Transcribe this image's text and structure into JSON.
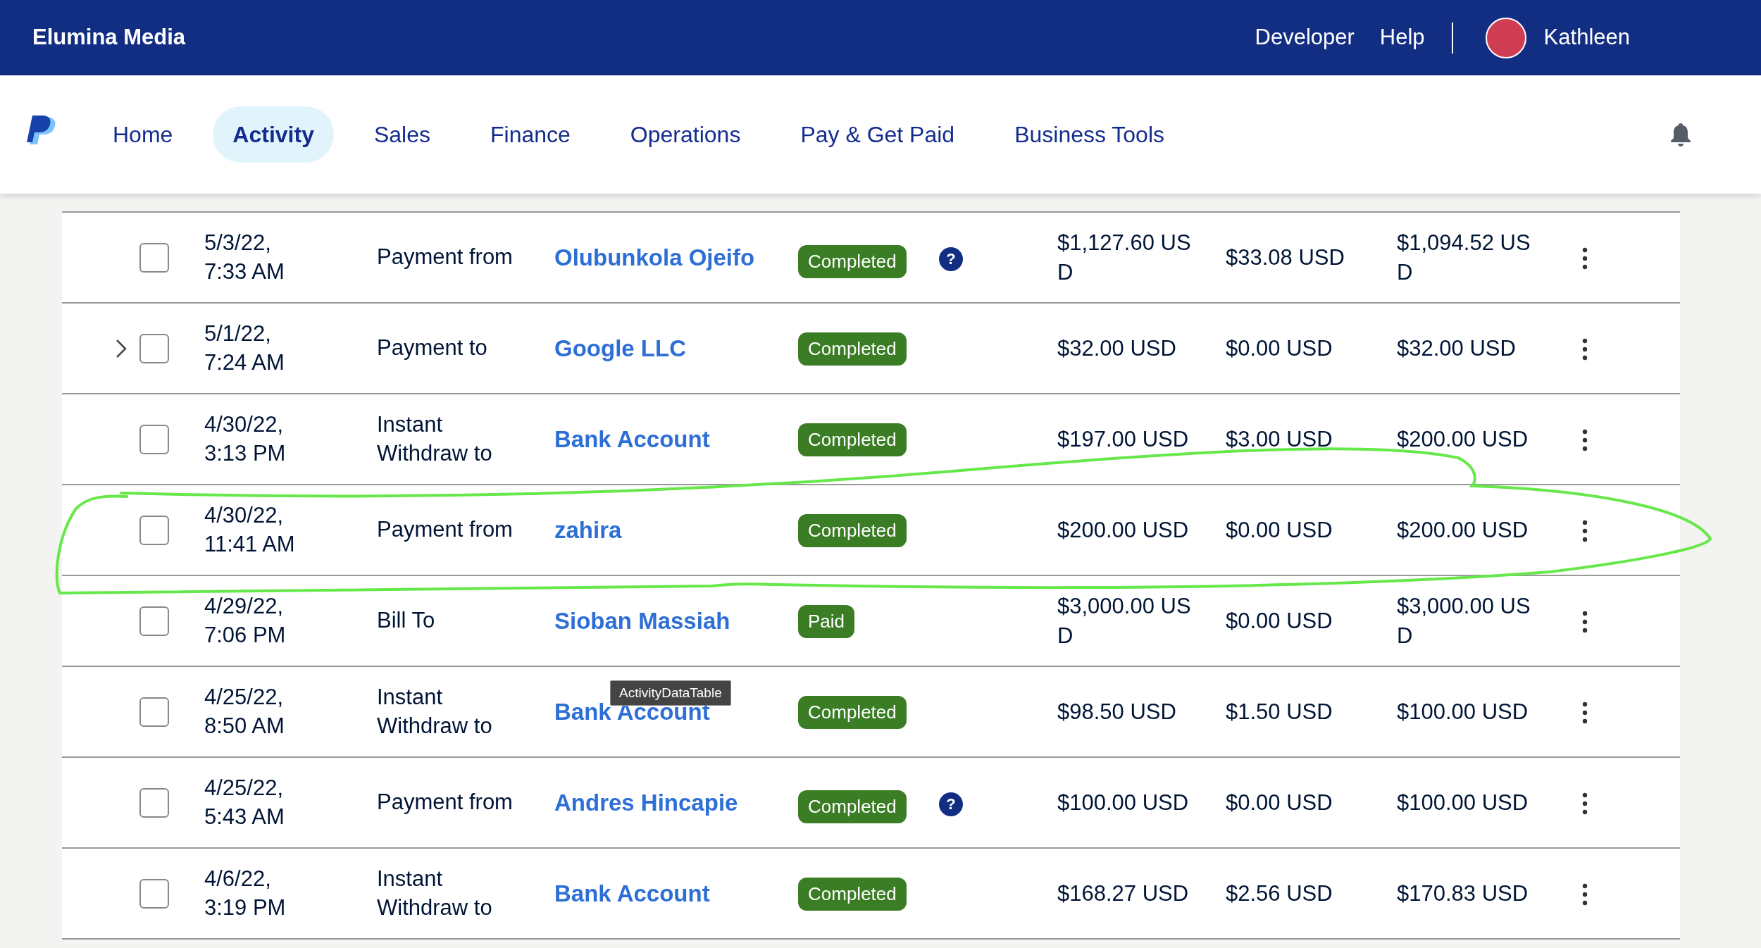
{
  "top_bar": {
    "brand": "Elumina Media",
    "links": [
      "Developer",
      "Help"
    ],
    "user": {
      "name": "Kathleen"
    }
  },
  "nav": {
    "tabs": [
      {
        "label": "Home",
        "selected": false
      },
      {
        "label": "Activity",
        "selected": true
      },
      {
        "label": "Sales",
        "selected": false
      },
      {
        "label": "Finance",
        "selected": false
      },
      {
        "label": "Operations",
        "selected": false
      },
      {
        "label": "Pay & Get Paid",
        "selected": false
      },
      {
        "label": "Business Tools",
        "selected": false
      }
    ]
  },
  "table": {
    "rows": [
      {
        "expandable": false,
        "checked": false,
        "date": "5/3/22,",
        "time": "7:33 AM",
        "type": "Payment from",
        "name": "Olubunkola Ojeifo",
        "status": "Completed",
        "help": "?",
        "gross": "$1,127.60 USD",
        "fee": "$33.08 USD",
        "net": "$1,094.52 USD"
      },
      {
        "expandable": true,
        "checked": false,
        "date": "5/1/22,",
        "time": "7:24 AM",
        "type": "Payment to",
        "name": "Google LLC",
        "status": "Completed",
        "gross": "$32.00 USD",
        "fee": "$0.00 USD",
        "net": "$32.00 USD"
      },
      {
        "expandable": false,
        "checked": false,
        "date": "4/30/22,",
        "time": "3:13 PM",
        "type": "Instant Withdraw to",
        "name": "Bank Account",
        "status": "Completed",
        "gross": "$197.00 USD",
        "fee": "$3.00 USD",
        "net": "$200.00 USD"
      },
      {
        "expandable": false,
        "checked": false,
        "date": "4/30/22,",
        "time": "11:41 AM",
        "type": "Payment from",
        "name": "zahira",
        "status": "Completed",
        "gross": "$200.00 USD",
        "fee": "$0.00 USD",
        "net": "$200.00 USD"
      },
      {
        "expandable": false,
        "checked": false,
        "date": "4/29/22,",
        "time": "7:06 PM",
        "type": "Bill To",
        "name": "Sioban Massiah",
        "status": "Paid",
        "gross": "$3,000.00 USD",
        "fee": "$0.00 USD",
        "net": "$3,000.00 USD"
      },
      {
        "expandable": false,
        "checked": false,
        "date": "4/25/22,",
        "time": "8:50 AM",
        "type": "Instant Withdraw to",
        "name": "Bank Account",
        "status": "Completed",
        "tooltip": "ActivityDataTable",
        "gross": "$98.50 USD",
        "fee": "$1.50 USD",
        "net": "$100.00 USD"
      },
      {
        "expandable": false,
        "checked": false,
        "date": "4/25/22,",
        "time": "5:43 AM",
        "type": "Payment from",
        "name": "Andres Hincapie",
        "status": "Completed",
        "help": "?",
        "gross": "$100.00 USD",
        "fee": "$0.00 USD",
        "net": "$100.00 USD"
      },
      {
        "expandable": false,
        "checked": false,
        "date": "4/6/22,",
        "time": "3:19 PM",
        "type": "Instant Withdraw to",
        "name": "Bank Account",
        "status": "Completed",
        "gross": "$168.27 USD",
        "fee": "$2.56 USD",
        "net": "$170.83 USD"
      }
    ]
  }
}
